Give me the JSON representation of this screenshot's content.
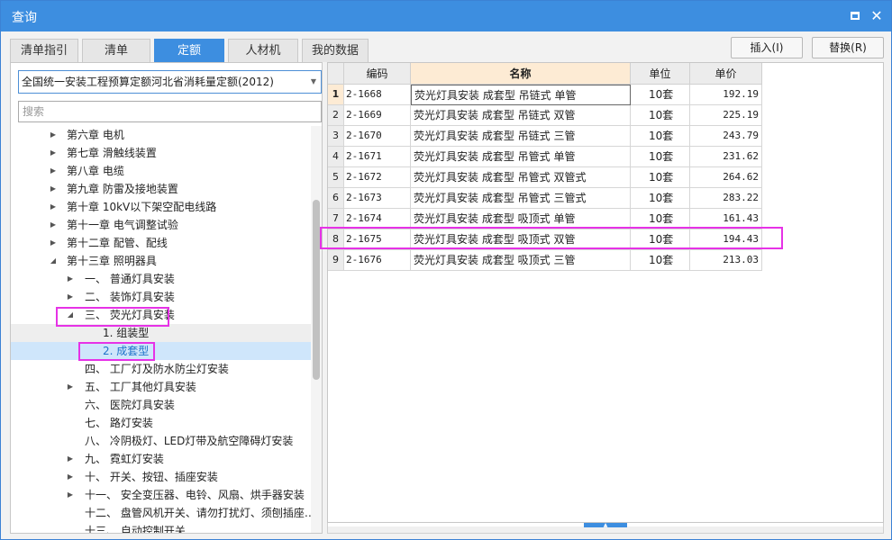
{
  "window": {
    "title": "查询"
  },
  "tabs": [
    {
      "label": "清单指引",
      "active": false
    },
    {
      "label": "清单",
      "active": false
    },
    {
      "label": "定额",
      "active": true
    },
    {
      "label": "人材机",
      "active": false
    },
    {
      "label": "我的数据",
      "active": false
    }
  ],
  "actions": {
    "insert_label": "插入(I)",
    "replace_label": "替换(R)"
  },
  "left": {
    "quota_book": "全国统一安装工程预算定额河北省消耗量定额(2012)",
    "search_placeholder": "搜索",
    "tree": [
      {
        "label": "第六章 电机",
        "level": 1,
        "arrow": "collapsed"
      },
      {
        "label": "第七章 滑触线装置",
        "level": 1,
        "arrow": "collapsed"
      },
      {
        "label": "第八章 电缆",
        "level": 1,
        "arrow": "collapsed"
      },
      {
        "label": "第九章 防雷及接地装置",
        "level": 1,
        "arrow": "collapsed"
      },
      {
        "label": "第十章 10kV以下架空配电线路",
        "level": 1,
        "arrow": "collapsed"
      },
      {
        "label": "第十一章 电气调整试验",
        "level": 1,
        "arrow": "collapsed"
      },
      {
        "label": "第十二章 配管、配线",
        "level": 1,
        "arrow": "collapsed"
      },
      {
        "label": "第十三章 照明器具",
        "level": 1,
        "arrow": "expanded"
      },
      {
        "label": "一、 普通灯具安装",
        "level": 2,
        "arrow": "collapsed"
      },
      {
        "label": "二、 装饰灯具安装",
        "level": 2,
        "arrow": "collapsed"
      },
      {
        "label": "三、 荧光灯具安装",
        "level": 2,
        "arrow": "expanded"
      },
      {
        "label": "1. 组装型",
        "level": 3,
        "arrow": "none",
        "state": "sub"
      },
      {
        "label": "2. 成套型",
        "level": 3,
        "arrow": "none",
        "state": "selected"
      },
      {
        "label": "四、 工厂灯及防水防尘灯安装",
        "level": 2,
        "arrow": "none"
      },
      {
        "label": "五、 工厂其他灯具安装",
        "level": 2,
        "arrow": "collapsed"
      },
      {
        "label": "六、 医院灯具安装",
        "level": 2,
        "arrow": "none"
      },
      {
        "label": "七、 路灯安装",
        "level": 2,
        "arrow": "none"
      },
      {
        "label": "八、 冷阴极灯、LED灯带及航空障碍灯安装",
        "level": 2,
        "arrow": "none"
      },
      {
        "label": "九、 霓虹灯安装",
        "level": 2,
        "arrow": "collapsed"
      },
      {
        "label": "十、 开关、按钮、插座安装",
        "level": 2,
        "arrow": "collapsed"
      },
      {
        "label": "十一、 安全变压器、电铃、风扇、烘手器安装",
        "level": 2,
        "arrow": "collapsed"
      },
      {
        "label": "十二、 盘管风机开关、请勿打扰灯、须刨插座…",
        "level": 2,
        "arrow": "none"
      },
      {
        "label": "十三、 自动控制开关",
        "level": 2,
        "arrow": "none"
      }
    ]
  },
  "grid": {
    "headers": {
      "code": "编码",
      "name": "名称",
      "unit": "单位",
      "price": "单价"
    },
    "rows": [
      {
        "num": "1",
        "code": "2-1668",
        "name": "荧光灯具安装 成套型 吊链式 单管",
        "unit": "10套",
        "price": "192.19"
      },
      {
        "num": "2",
        "code": "2-1669",
        "name": "荧光灯具安装 成套型 吊链式 双管",
        "unit": "10套",
        "price": "225.19"
      },
      {
        "num": "3",
        "code": "2-1670",
        "name": "荧光灯具安装 成套型 吊链式 三管",
        "unit": "10套",
        "price": "243.79"
      },
      {
        "num": "4",
        "code": "2-1671",
        "name": "荧光灯具安装 成套型 吊管式 单管",
        "unit": "10套",
        "price": "231.62"
      },
      {
        "num": "5",
        "code": "2-1672",
        "name": "荧光灯具安装 成套型 吊管式 双管式",
        "unit": "10套",
        "price": "264.62"
      },
      {
        "num": "6",
        "code": "2-1673",
        "name": "荧光灯具安装 成套型 吊管式 三管式",
        "unit": "10套",
        "price": "283.22"
      },
      {
        "num": "7",
        "code": "2-1674",
        "name": "荧光灯具安装 成套型 吸顶式 单管",
        "unit": "10套",
        "price": "161.43"
      },
      {
        "num": "8",
        "code": "2-1675",
        "name": "荧光灯具安装 成套型 吸顶式 双管",
        "unit": "10套",
        "price": "194.43"
      },
      {
        "num": "9",
        "code": "2-1676",
        "name": "荧光灯具安装 成套型 吸顶式 三管",
        "unit": "10套",
        "price": "213.03"
      }
    ]
  }
}
